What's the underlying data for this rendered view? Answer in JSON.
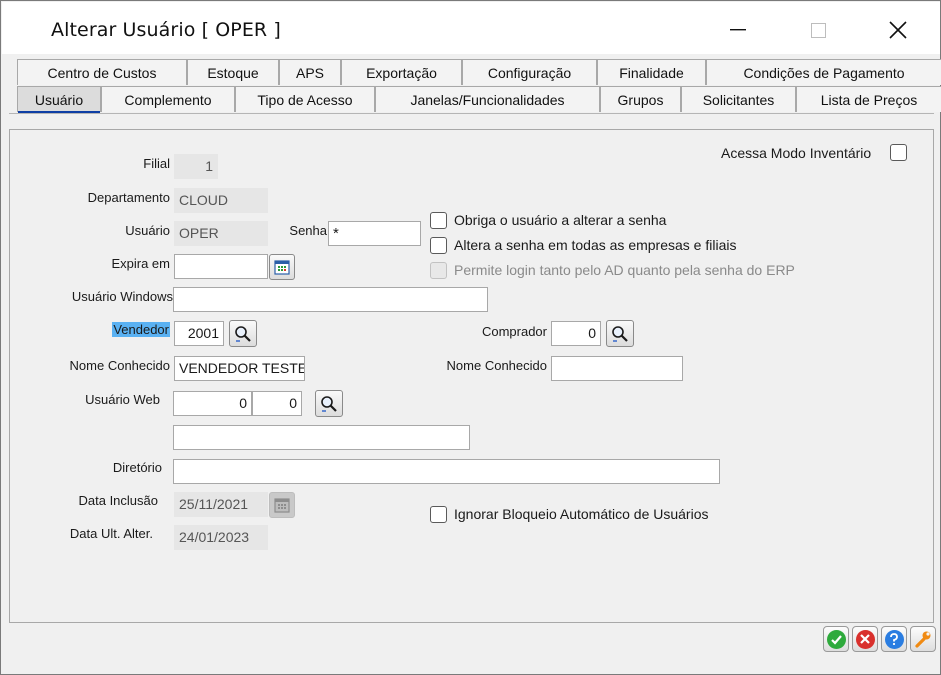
{
  "window": {
    "title": "Alterar Usuário [ OPER ]"
  },
  "tabs_row1": [
    {
      "label": "Centro de Custos"
    },
    {
      "label": "Estoque"
    },
    {
      "label": "APS"
    },
    {
      "label": "Exportação"
    },
    {
      "label": "Configuração"
    },
    {
      "label": "Finalidade"
    },
    {
      "label": "Condições de Pagamento"
    }
  ],
  "tabs_row2": [
    {
      "label": "Usuário",
      "active": true
    },
    {
      "label": "Complemento"
    },
    {
      "label": "Tipo de Acesso"
    },
    {
      "label": "Janelas/Funcionalidades"
    },
    {
      "label": "Grupos"
    },
    {
      "label": "Solicitantes"
    },
    {
      "label": "Lista de Preços"
    }
  ],
  "form": {
    "filial_label": "Filial",
    "filial_value": "1",
    "departamento_label": "Departamento",
    "departamento_value": "CLOUD",
    "usuario_label": "Usuário",
    "usuario_value": "OPER",
    "senha_label": "Senha",
    "senha_value": "*",
    "expira_label": "Expira em",
    "expira_value": "",
    "usuario_windows_label": "Usuário Windows",
    "usuario_windows_value": "",
    "vendedor_label": "Vendedor",
    "vendedor_value": "2001",
    "comprador_label": "Comprador",
    "comprador_value": "0",
    "nome_conhecido_label": "Nome Conhecido",
    "nome_conhecido_value": "VENDEDOR TESTE",
    "nome_conhecido2_label": "Nome Conhecido",
    "nome_conhecido2_value": "",
    "usuario_web_label": "Usuário Web",
    "usuario_web_value1": "0",
    "usuario_web_value2": "0",
    "usuario_web_name": "",
    "diretorio_label": "Diretório",
    "diretorio_value": "",
    "data_inclusao_label": "Data Inclusão",
    "data_inclusao_value": "25/11/2021",
    "data_ult_alter_label": "Data Ult. Alter.",
    "data_ult_alter_value": "24/01/2023"
  },
  "checkboxes": {
    "acessa_modo_inventario": {
      "label": "Acessa Modo Inventário",
      "checked": false
    },
    "obriga_alterar_senha": {
      "label": "Obriga o usuário a alterar a senha",
      "checked": false
    },
    "altera_senha_empresas": {
      "label": "Altera a senha em todas as empresas e filiais",
      "checked": false
    },
    "permite_login_ad": {
      "label": "Permite login tanto pelo AD quanto pela senha do ERP",
      "checked": false,
      "disabled": true
    },
    "ignorar_bloqueio": {
      "label": "Ignorar Bloqueio Automático de Usuários",
      "checked": false
    }
  },
  "colors": {
    "ok": "#2eaa3c",
    "cancel": "#d9302c",
    "help": "#2a7de1",
    "tools": "#f08a12",
    "highlight": "#5ab1f2",
    "tab_selected_bar": "#0f3fa5"
  },
  "icons": {
    "ok": "check-icon",
    "cancel": "x-icon",
    "help": "question-icon",
    "tools": "wrench-icon",
    "lookup": "magnifier-icon",
    "calendar": "calendar-icon"
  }
}
